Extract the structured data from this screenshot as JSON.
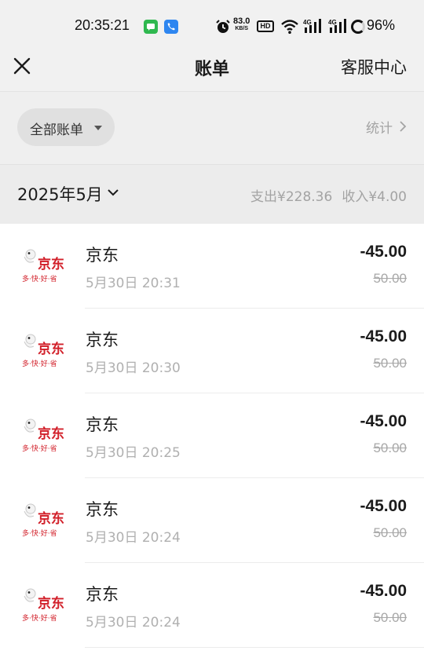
{
  "status_bar": {
    "time": "20:35:21",
    "net_speed_value": "83.0",
    "net_speed_unit": "KB/S",
    "hd_label": "HD",
    "signal1_label": "4G",
    "signal2_label": "4G",
    "battery": "96%",
    "icons": [
      "messages-icon",
      "phone-icon",
      "alarm-icon",
      "wifi-icon",
      "signal-icon",
      "battery-icon"
    ],
    "colors": {
      "messages": "#2fb84f",
      "phone": "#2e86f0"
    }
  },
  "header": {
    "title": "账单",
    "service_label": "客服中心",
    "close_icon": "close-icon"
  },
  "filter": {
    "label": "全部账单",
    "stats_label": "统计"
  },
  "month": {
    "label": "2025年5月",
    "expense": "支出¥228.36",
    "income": "收入¥4.00"
  },
  "transactions": [
    {
      "merchant": "京东",
      "time": "5月30日 20:31",
      "amount": "-45.00",
      "original": "50.00"
    },
    {
      "merchant": "京东",
      "time": "5月30日 20:30",
      "amount": "-45.00",
      "original": "50.00"
    },
    {
      "merchant": "京东",
      "time": "5月30日 20:25",
      "amount": "-45.00",
      "original": "50.00"
    },
    {
      "merchant": "京东",
      "time": "5月30日 20:24",
      "amount": "-45.00",
      "original": "50.00"
    },
    {
      "merchant": "京东",
      "time": "5月30日 20:24",
      "amount": "-45.00",
      "original": "50.00"
    }
  ],
  "logo": {
    "brand_text": "京东",
    "tagline": "多·快·好·省",
    "brand_color": "#d2202a"
  }
}
